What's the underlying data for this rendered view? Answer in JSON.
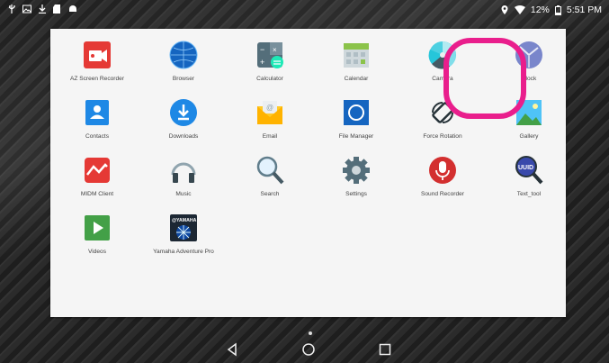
{
  "status_bar": {
    "battery_text": "12%",
    "time": "5:51 PM",
    "left_icons": [
      "usb-icon",
      "image-icon",
      "download-icon",
      "sd-card-icon",
      "android-icon"
    ],
    "right_icons": [
      "location-icon",
      "wifi-icon",
      "battery-icon"
    ]
  },
  "apps": [
    {
      "label": "AZ Screen Recorder"
    },
    {
      "label": "Browser"
    },
    {
      "label": "Calculator"
    },
    {
      "label": "Calendar"
    },
    {
      "label": "Camera"
    },
    {
      "label": "Clock"
    },
    {
      "label": "Contacts"
    },
    {
      "label": "Downloads"
    },
    {
      "label": "Email"
    },
    {
      "label": "File Manager"
    },
    {
      "label": "Force Rotation"
    },
    {
      "label": "Gallery"
    },
    {
      "label": "MIDM Client"
    },
    {
      "label": "Music"
    },
    {
      "label": "Search"
    },
    {
      "label": "Settings"
    },
    {
      "label": "Sound Recorder"
    },
    {
      "label": "Text_tool"
    },
    {
      "label": "Videos"
    },
    {
      "label": "Yamaha Adventure Pro"
    }
  ],
  "icon_texts": {
    "yamaha": "@YAMAHA",
    "uuid": "UUID"
  },
  "highlight_color": "#e91e8c",
  "nav": {
    "buttons": [
      "back-button",
      "home-button",
      "recents-button"
    ]
  }
}
